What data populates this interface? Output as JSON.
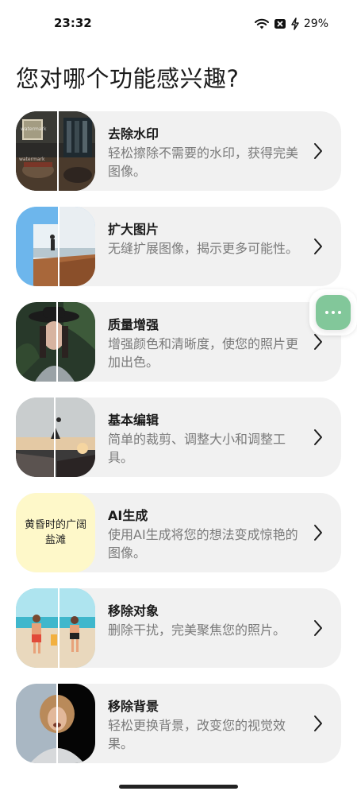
{
  "status_bar": {
    "time": "23:32",
    "battery": "29%",
    "icons": [
      "wifi-icon",
      "notification-x-icon",
      "charging-bolt-icon"
    ]
  },
  "page": {
    "title": "您对哪个功能感兴趣?"
  },
  "features": [
    {
      "title": "去除水印",
      "description": "轻松擦除不需要的水印，获得完美图像。",
      "icon": "chevron-right-icon"
    },
    {
      "title": "扩大图片",
      "description": "无缝扩展图像，揭示更多可能性。",
      "icon": "chevron-right-icon"
    },
    {
      "title": "质量增强",
      "description": "增强颜色和清晰度，使您的照片更加出色。",
      "icon": "chevron-right-icon"
    },
    {
      "title": "基本编辑",
      "description": "简单的裁剪、调整大小和调整工具。",
      "icon": "chevron-right-icon"
    },
    {
      "title": "AI生成",
      "description": "使用AI生成将您的想法变成惊艳的图像。",
      "thumb_text": "黄昏时的广阔盐滩",
      "icon": "chevron-right-icon"
    },
    {
      "title": "移除对象",
      "description": "删除干扰，完美聚焦您的照片。",
      "icon": "chevron-right-icon"
    },
    {
      "title": "移除背景",
      "description": "轻松更换背景，改变您的视觉效果。",
      "icon": "chevron-right-icon"
    }
  ],
  "floating_button": {
    "icon": "more-dots-icon",
    "color": "#82c79a"
  },
  "colors": {
    "card_bg": "#f1f1f1",
    "ai_thumb_bg": "#fef8c9",
    "description_text": "#7a7a7a"
  }
}
